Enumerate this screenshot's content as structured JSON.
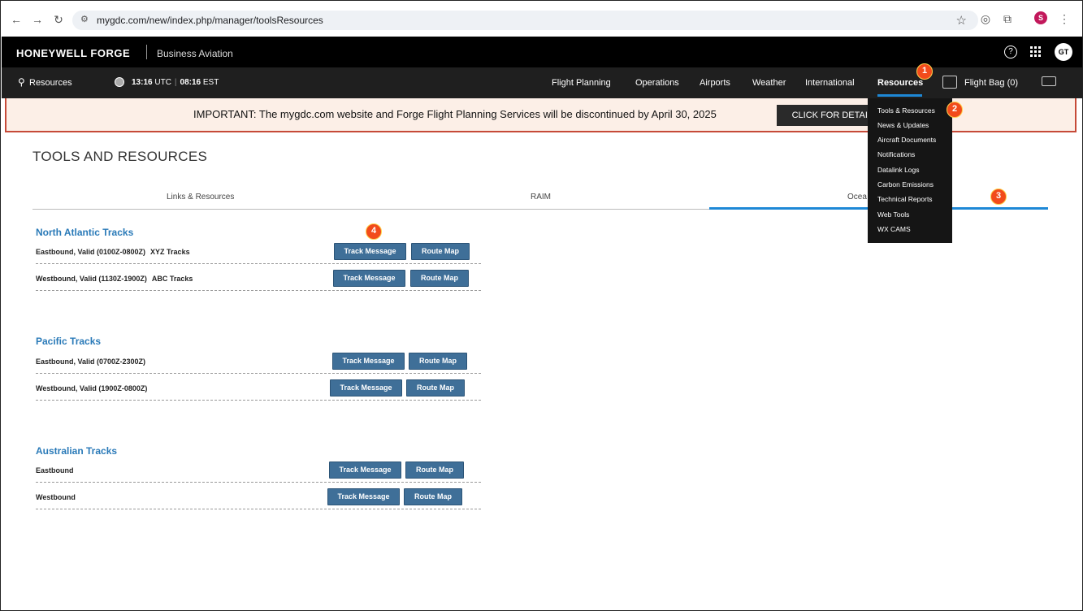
{
  "browser": {
    "url": "mygdc.com/new/index.php/manager/toolsResources",
    "profile_initial": "S"
  },
  "app": {
    "brand": "HONEYWELL FORGE",
    "brand_sub": "Business Aviation",
    "avatar": "GT"
  },
  "nav": {
    "left_label": "Resources",
    "utc_time": "13:16",
    "utc_label": "UTC",
    "est_time": "08:16",
    "est_label": "EST",
    "items": [
      "Flight Planning",
      "Operations",
      "Airports",
      "Weather",
      "International",
      "Resources"
    ],
    "flight_bag": "Flight Bag (0)"
  },
  "banner": {
    "text": "IMPORTANT: The mygdc.com website and Forge Flight Planning Services will be discontinued by April 30, 2025",
    "button": "CLICK FOR DETAILS"
  },
  "dropdown": {
    "items": [
      "Tools & Resources",
      "News & Updates",
      "Aircraft Documents",
      "Notifications",
      "Datalink Logs",
      "Carbon Emissions",
      "Technical Reports",
      "Web Tools",
      "WX CAMS"
    ]
  },
  "page": {
    "title": "TOOLS AND RESOURCES",
    "tabs": [
      "Links & Resources",
      "RAIM",
      "Ocea"
    ]
  },
  "sections": [
    {
      "title": "North Atlantic Tracks",
      "rows": [
        {
          "label": "Eastbound, Valid (0100Z-0800Z)",
          "extra": "XYZ Tracks"
        },
        {
          "label": "Westbound, Valid (1130Z-1900Z)",
          "extra": "ABC Tracks"
        }
      ]
    },
    {
      "title": "Pacific Tracks",
      "rows": [
        {
          "label": "Eastbound, Valid (0700Z-2300Z)",
          "extra": ""
        },
        {
          "label": "Westbound, Valid (1900Z-0800Z)",
          "extra": ""
        }
      ]
    },
    {
      "title": "Australian Tracks",
      "rows": [
        {
          "label": "Eastbound",
          "extra": ""
        },
        {
          "label": "Westbound",
          "extra": ""
        }
      ]
    }
  ],
  "buttons": {
    "track_message": "Track Message",
    "route_map": "Route Map"
  },
  "markers": [
    "1",
    "2",
    "3",
    "4"
  ],
  "colors": {
    "accent": "#1e88d6",
    "button": "#3f6f98",
    "section_title": "#2a7ab8",
    "marker": "#f24b1b",
    "banner_bg": "#fcefe7",
    "banner_border": "#c64a38"
  }
}
